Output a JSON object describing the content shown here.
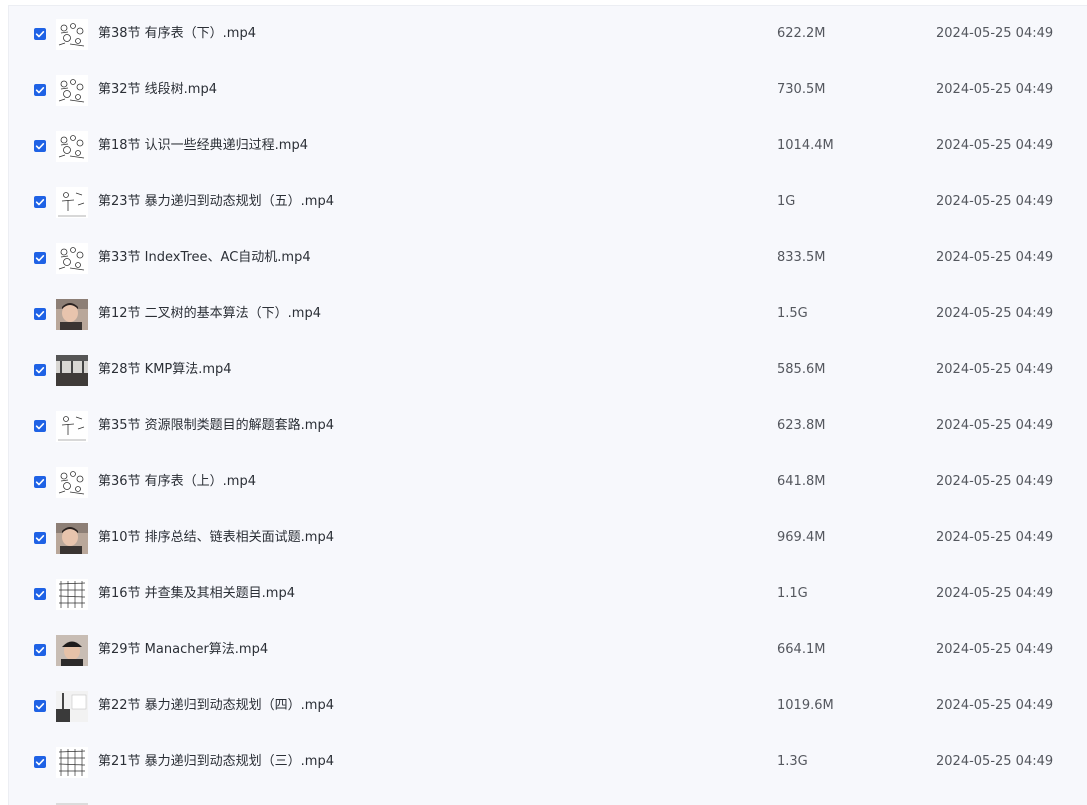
{
  "files": [
    {
      "name": "第38节 有序表（下）.mp4",
      "size": "622.2M",
      "modified": "2024-05-25 04:49",
      "thumb": "sketch-circles",
      "checked": true
    },
    {
      "name": "第32节 线段树.mp4",
      "size": "730.5M",
      "modified": "2024-05-25 04:49",
      "thumb": "sketch-circles",
      "checked": true
    },
    {
      "name": "第18节 认识一些经典递归过程.mp4",
      "size": "1014.4M",
      "modified": "2024-05-25 04:49",
      "thumb": "sketch-circles",
      "checked": true
    },
    {
      "name": "第23节 暴力递归到动态规划（五）.mp4",
      "size": "1G",
      "modified": "2024-05-25 04:49",
      "thumb": "sketch-lines",
      "checked": true
    },
    {
      "name": "第33节 IndexTree、AC自动机.mp4",
      "size": "833.5M",
      "modified": "2024-05-25 04:49",
      "thumb": "sketch-circles",
      "checked": true
    },
    {
      "name": "第12节 二叉树的基本算法（下）.mp4",
      "size": "1.5G",
      "modified": "2024-05-25 04:49",
      "thumb": "person",
      "checked": true
    },
    {
      "name": "第28节 KMP算法.mp4",
      "size": "585.6M",
      "modified": "2024-05-25 04:49",
      "thumb": "room",
      "checked": true
    },
    {
      "name": "第35节 资源限制类题目的解题套路.mp4",
      "size": "623.8M",
      "modified": "2024-05-25 04:49",
      "thumb": "sketch-lines",
      "checked": true
    },
    {
      "name": "第36节 有序表（上）.mp4",
      "size": "641.8M",
      "modified": "2024-05-25 04:49",
      "thumb": "sketch-circles",
      "checked": true
    },
    {
      "name": "第10节 排序总结、链表相关面试题.mp4",
      "size": "969.4M",
      "modified": "2024-05-25 04:49",
      "thumb": "person",
      "checked": true
    },
    {
      "name": "第16节 并查集及其相关题目.mp4",
      "size": "1.1G",
      "modified": "2024-05-25 04:49",
      "thumb": "grid",
      "checked": true
    },
    {
      "name": "第29节 Manacher算法.mp4",
      "size": "664.1M",
      "modified": "2024-05-25 04:49",
      "thumb": "person-cap",
      "checked": true
    },
    {
      "name": "第22节 暴力递归到动态规划（四）.mp4",
      "size": "1019.6M",
      "modified": "2024-05-25 04:49",
      "thumb": "board",
      "checked": true
    },
    {
      "name": "第21节 暴力递归到动态规划（三）.mp4",
      "size": "1.3G",
      "modified": "2024-05-25 04:49",
      "thumb": "grid",
      "checked": true
    }
  ],
  "colors": {
    "checkbox": "#1f62e5",
    "panel_bg": "#f7f8fc",
    "text_primary": "#2b2f36",
    "text_secondary": "#54575e"
  }
}
